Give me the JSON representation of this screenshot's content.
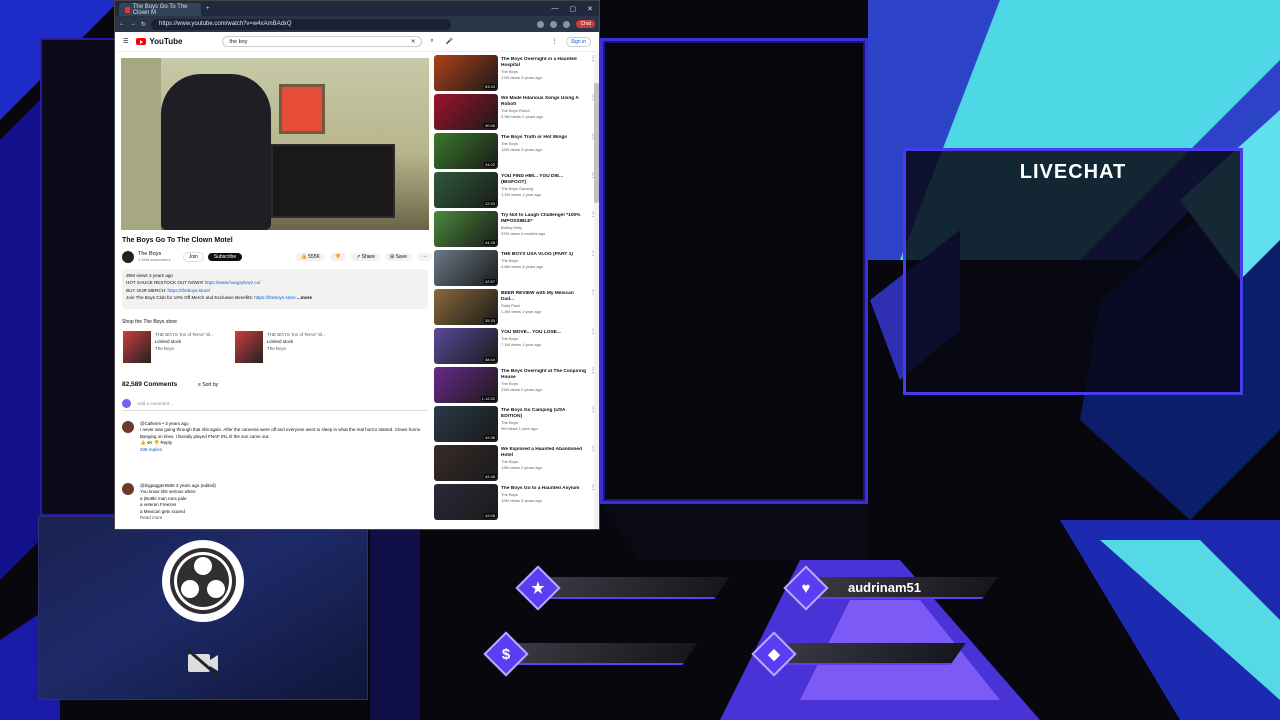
{
  "browser": {
    "tab_title": "The Boys Go To The Clown M",
    "url": "https://www.youtube.com/watch?v=w4xAmBAdxQ",
    "chat_label": "Chat"
  },
  "youtube": {
    "logo_text": "YouTube",
    "search_value": "the boy",
    "signin_label": "Sign in",
    "video": {
      "title": "The Boys Go To The Clown Motel",
      "channel": "The Boys",
      "subs": "1.34M subscribers",
      "join": "Join",
      "subscribe": "Subscribe",
      "likes": "555K",
      "share": "Share",
      "save": "Save",
      "desc_line1": "35M views  3 years ago",
      "desc_line2_a": "HOT SAUCE RESTOCK OUT NOW!!! ",
      "desc_line2_link": "https://www.hungryboyz.co/",
      "desc_line3_a": "BUY OUR MERCH: ",
      "desc_line3_link": "https://theboys.store/",
      "desc_line4_a": "Join The Boys Club for 10% Off Merch and Exclusive Benefits: ",
      "desc_line4_link": "https://theboys.store",
      "desc_more": "...more"
    },
    "store": {
      "title": "Shop the The Boys store",
      "items": [
        {
          "name": "THE BOYS 'Inn of Terror' Sl...",
          "stock": "Limited stock",
          "seller": "The Boys"
        },
        {
          "name": "THE BOYS 'Inn of Terror' Sl...",
          "stock": "Limited stock",
          "seller": "The Boys"
        }
      ]
    },
    "comments": {
      "count": "82,589 Comments",
      "sort": "Sort by",
      "add_placeholder": "Add a comment...",
      "items": [
        {
          "user": "@Callenm  •  3 years ago",
          "text": "I never was going through that shit again. After the cameras were off and everyone went to sleep in what the real horror started. Clown horns. Banging on lines. I literally played FNAF IRL til the sun came out.",
          "likes": "4K",
          "reply": "Reply",
          "replies": "338 replies"
        },
        {
          "user": "@bigpagger5566  3 years ago (edited)",
          "text": "You know shit serious when:\na (Bottle man runs pale\na veteran Freezes\na Mexican gets scared",
          "likes": "",
          "reply": "",
          "replies": "Read more"
        }
      ]
    },
    "sidebar": [
      {
        "title": "The Boys Overnight in a Haunted Hospital",
        "channel": "The Boys",
        "views": "17M views  3 years ago",
        "dur": "53:33",
        "color": "#b0401a"
      },
      {
        "title": "We Made Hilarious Songs Using A Robot!",
        "channel": "The Boys Robot",
        "views": "3.9M views  2 years ago",
        "dur": "30:45",
        "color": "#a0122a"
      },
      {
        "title": "The Boys Truth or Hot Wings",
        "channel": "The Boys",
        "views": "12M views  3 years ago",
        "dur": "34:22",
        "color": "#3a7a2a"
      },
      {
        "title": "YOU FIND HIM... YOU DIE... (BIGFOOT)",
        "channel": "The Boys Gaming",
        "views": "1.1M views  1 year ago",
        "dur": "22:33",
        "color": "#2f5a3a"
      },
      {
        "title": "Try Not to Laugh Challenge! *100% IMPOSSIBLE*",
        "channel": "Bobby Kelly",
        "views": "37M views  4 months ago",
        "dur": "44:28",
        "color": "#4a8a3a"
      },
      {
        "title": "THE BOYS USA VLOG (PART 1)",
        "channel": "The Boys",
        "views": "4.6M views  3 years ago",
        "dur": "42:57",
        "color": "#6a7a88"
      },
      {
        "title": "BEER REVIEW with My Mexican Dad...",
        "channel": "Rolla Pack",
        "views": "1.4M views  1 year ago",
        "dur": "35:33",
        "color": "#8a6a3a"
      },
      {
        "title": "YOU MOVE... YOU LOSE...",
        "channel": "The Boys",
        "views": "7.1M views  1 year ago",
        "dur": "48:44",
        "color": "#5a4a9a"
      },
      {
        "title": "The Boys Overnight at The Conjuring House",
        "channel": "The Boys",
        "views": "21M views  2 years ago",
        "dur": "1:12:32",
        "color": "#6a2a8a"
      },
      {
        "title": "The Boys Go Camping (USA EDITION)",
        "channel": "The Boys",
        "views": "9M views  1 year ago",
        "dur": "42:38",
        "color": "#2a3a4a"
      },
      {
        "title": "We Explored a Haunted Abandoned Hotel",
        "channel": "The Boys",
        "views": "13M views  2 years ago",
        "dur": "42:48",
        "color": "#3a2a2a"
      },
      {
        "title": "The Boys Go to a Haunted Asylum",
        "channel": "The Boys",
        "views": "12M views  3 years ago",
        "dur": "42:08",
        "color": "#2a2a3a"
      }
    ]
  },
  "overlay": {
    "livechat_title": "LIVECHAT",
    "alerts": [
      {
        "icon": "star-icon",
        "glyph": "★",
        "label": ""
      },
      {
        "icon": "heart-icon",
        "glyph": "♥",
        "label": "audrinam51"
      },
      {
        "icon": "dollar-icon",
        "glyph": "$",
        "label": ""
      },
      {
        "icon": "diamond-icon",
        "glyph": "◆",
        "label": ""
      }
    ],
    "accent": "#5a3ef2",
    "cyan": "#2ec8d8"
  }
}
